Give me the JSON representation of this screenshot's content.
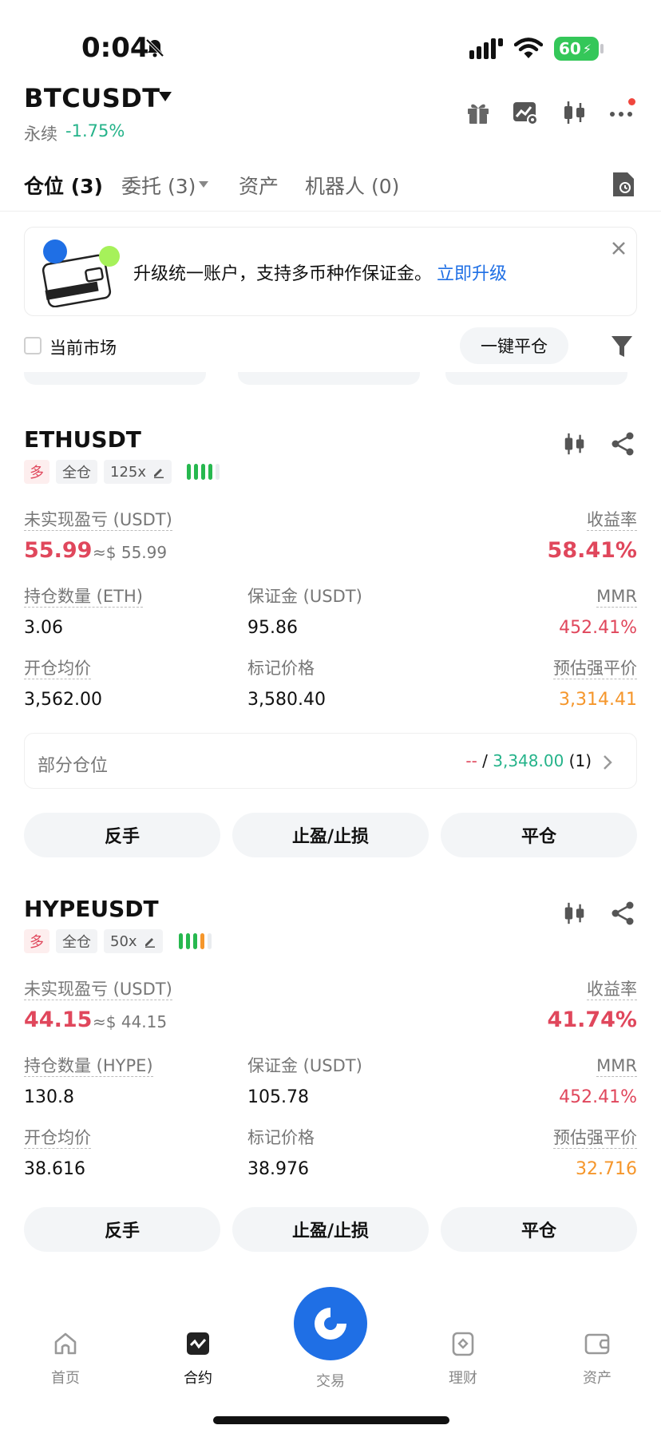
{
  "status_bar": {
    "time": "0:04",
    "battery": "60"
  },
  "header": {
    "pair": "BTCUSDT",
    "perp_label": "永续",
    "change": "-1.75%"
  },
  "tabs": [
    {
      "label": "仓位 (3)"
    },
    {
      "label": "委托 (3)"
    },
    {
      "label": "资产"
    },
    {
      "label": "机器人 (0)"
    }
  ],
  "banner": {
    "text": "升级统一账户，支持多币种作保证金。",
    "link": "立即升级"
  },
  "filter": {
    "current_market": "当前市场",
    "close_all": "一键平仓"
  },
  "colors": {
    "accent": "#1f6fe5",
    "loss_red": "#e0475c",
    "gain_green": "#25b38a",
    "liq_orange": "#f5962b"
  },
  "positions": [
    {
      "symbol": "ETHUSDT",
      "side": "多",
      "margin_mode": "全仓",
      "leverage": "125x",
      "risk_bars": [
        "#27b84f",
        "#27b84f",
        "#27b84f",
        "#27b84f",
        "#e9ecef"
      ],
      "pnl_label": "未实现盈亏 (USDT)",
      "pnl": "55.99",
      "pnl_approx": "≈$ 55.99",
      "roe_label": "收益率",
      "roe": "58.41%",
      "size_label": "持仓数量 (ETH)",
      "size": "3.06",
      "margin_label": "保证金 (USDT)",
      "margin": "95.86",
      "mmr_label": "MMR",
      "mmr": "452.41%",
      "entry_label": "开仓均价",
      "entry": "3,562.00",
      "mark_label": "标记价格",
      "mark": "3,580.40",
      "liq_label": "预估强平价",
      "liq": "3,314.41",
      "partial": {
        "label": "部分仓位",
        "tp": "--",
        "sep": " / ",
        "sl": "3,348.00",
        "count": " (1)"
      },
      "actions": {
        "reverse": "反手",
        "tpsl": "止盈/止损",
        "close": "平仓"
      }
    },
    {
      "symbol": "HYPEUSDT",
      "side": "多",
      "margin_mode": "全仓",
      "leverage": "50x",
      "risk_bars": [
        "#27b84f",
        "#27b84f",
        "#27b84f",
        "#f5962b",
        "#e9ecef"
      ],
      "pnl_label": "未实现盈亏 (USDT)",
      "pnl": "44.15",
      "pnl_approx": "≈$ 44.15",
      "roe_label": "收益率",
      "roe": "41.74%",
      "size_label": "持仓数量 (HYPE)",
      "size": "130.8",
      "margin_label": "保证金 (USDT)",
      "margin": "105.78",
      "mmr_label": "MMR",
      "mmr": "452.41%",
      "entry_label": "开仓均价",
      "entry": "38.616",
      "mark_label": "标记价格",
      "mark": "38.976",
      "liq_label": "预估强平价",
      "liq": "32.716",
      "actions": {
        "reverse": "反手",
        "tpsl": "止盈/止损",
        "close": "平仓"
      }
    }
  ],
  "bottom_nav": [
    {
      "label": "首页",
      "icon": "home-icon"
    },
    {
      "label": "合约",
      "icon": "futures-icon"
    },
    {
      "label": "交易",
      "icon": "trade-icon"
    },
    {
      "label": "理财",
      "icon": "earn-icon"
    },
    {
      "label": "资产",
      "icon": "wallet-icon"
    }
  ]
}
